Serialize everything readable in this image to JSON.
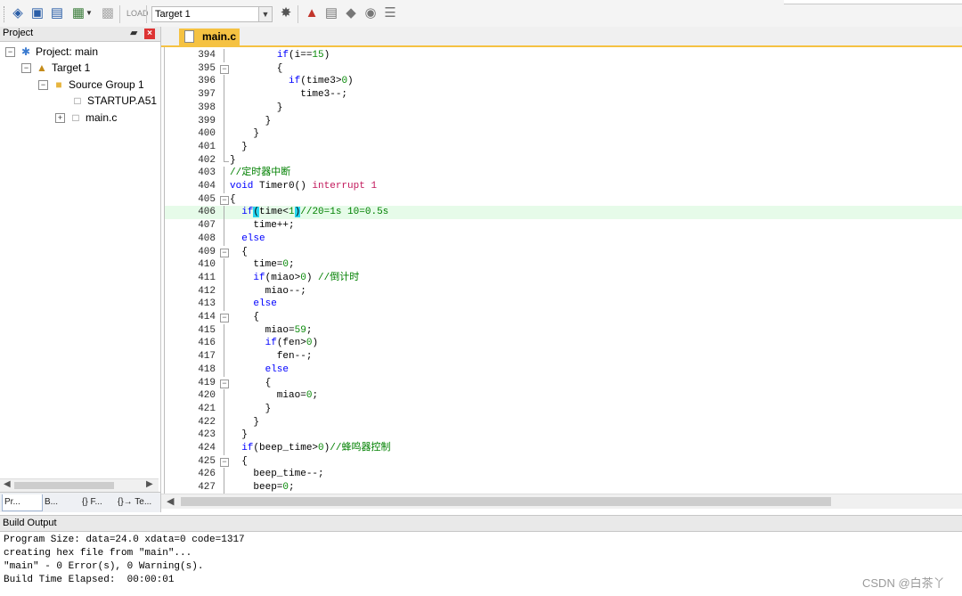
{
  "toolbar": {
    "target_value": "Target 1",
    "icons": [
      "translate-icon",
      "build-icon",
      "rebuild-icon",
      "batch-build-icon",
      "stop-build-icon",
      "download-icon",
      "target-options-icon",
      "manage-components-icon",
      "select-packs-icon",
      "pack-installer-icon",
      "rte-icon",
      "book-icon"
    ]
  },
  "project": {
    "title": "Project",
    "tree": [
      {
        "label": "Project: main",
        "icon": "project-icon"
      },
      {
        "label": "Target 1",
        "icon": "target-icon"
      },
      {
        "label": "Source Group 1",
        "icon": "folder-icon"
      },
      {
        "label": "STARTUP.A51",
        "icon": "file-icon"
      },
      {
        "label": "main.c",
        "icon": "file-icon"
      }
    ],
    "tabs": [
      "Pr...",
      "B...",
      "{} F...",
      "{}→ Te..."
    ]
  },
  "editor": {
    "file_tab": "main.c",
    "lines": [
      {
        "n": "394",
        "t": "        if(i==15)"
      },
      {
        "n": "395",
        "t": "        {"
      },
      {
        "n": "396",
        "t": "          if(time3>0)"
      },
      {
        "n": "397",
        "t": "            time3--;"
      },
      {
        "n": "398",
        "t": "        }"
      },
      {
        "n": "399",
        "t": "      }"
      },
      {
        "n": "400",
        "t": "    }"
      },
      {
        "n": "401",
        "t": "  }"
      },
      {
        "n": "402",
        "t": "}"
      },
      {
        "n": "403",
        "t": "//定时器中断"
      },
      {
        "n": "404",
        "t": "void Timer0() interrupt 1"
      },
      {
        "n": "405",
        "t": "{"
      },
      {
        "n": "406",
        "t": "  if(time<1)//20=1s 10=0.5s"
      },
      {
        "n": "407",
        "t": "    time++;"
      },
      {
        "n": "408",
        "t": "  else"
      },
      {
        "n": "409",
        "t": "  {"
      },
      {
        "n": "410",
        "t": "    time=0;"
      },
      {
        "n": "411",
        "t": "    if(miao>0) //倒计时"
      },
      {
        "n": "412",
        "t": "      miao--;"
      },
      {
        "n": "413",
        "t": "    else"
      },
      {
        "n": "414",
        "t": "    {"
      },
      {
        "n": "415",
        "t": "      miao=59;"
      },
      {
        "n": "416",
        "t": "      if(fen>0)"
      },
      {
        "n": "417",
        "t": "        fen--;"
      },
      {
        "n": "418",
        "t": "      else"
      },
      {
        "n": "419",
        "t": "      {"
      },
      {
        "n": "420",
        "t": "        miao=0;"
      },
      {
        "n": "421",
        "t": "      }"
      },
      {
        "n": "422",
        "t": "    }"
      },
      {
        "n": "423",
        "t": "  }"
      },
      {
        "n": "424",
        "t": "  if(beep_time>0)//蜂鸣器控制"
      },
      {
        "n": "425",
        "t": "  {"
      },
      {
        "n": "426",
        "t": "    beep_time--;"
      },
      {
        "n": "427",
        "t": "    beep=0;"
      }
    ]
  },
  "build": {
    "title": "Build Output",
    "lines": [
      "Program Size: data=24.0 xdata=0 code=1317",
      "creating hex file from \"main\"...",
      "\"main\" - 0 Error(s), 0 Warning(s).",
      "Build Time Elapsed:  00:00:01"
    ]
  },
  "watermark": "CSDN @白茶丫"
}
